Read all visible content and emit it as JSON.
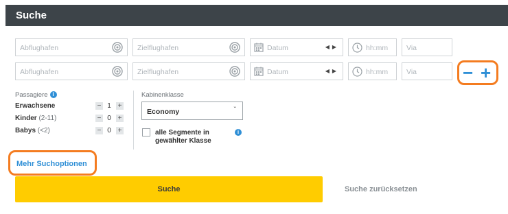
{
  "header": {
    "title": "Suche"
  },
  "rows": [
    {
      "from": "Abflughafen",
      "to": "Zielflughafen",
      "date": "Datum",
      "time": "hh:mm",
      "via": "Via"
    },
    {
      "from": "Abflughafen",
      "to": "Zielflughafen",
      "date": "Datum",
      "time": "hh:mm",
      "via": "Via"
    }
  ],
  "row_controls": {
    "minus": "−",
    "plus": "+"
  },
  "passengers": {
    "label": "Passagiere",
    "adults": {
      "label": "Erwachsene",
      "sub": "",
      "value": "1"
    },
    "children": {
      "label": "Kinder",
      "sub": "(2-11)",
      "value": "0"
    },
    "babies": {
      "label": "Babys",
      "sub": "(<2)",
      "value": "0"
    },
    "minus": "−",
    "plus": "+"
  },
  "cabin": {
    "label": "Kabinenklasse",
    "selected": "Economy",
    "checkbox_label": "alle Segmente in gewählter Klasse"
  },
  "more_options": "Mehr Suchoptionen",
  "search_button": "Suche",
  "reset_button": "Suche zurücksetzen",
  "colors": {
    "header_bg": "#3d4449",
    "accent_blue": "#2f8fd6",
    "highlight_orange": "#f47c20",
    "search_yellow": "#ffcc00"
  }
}
